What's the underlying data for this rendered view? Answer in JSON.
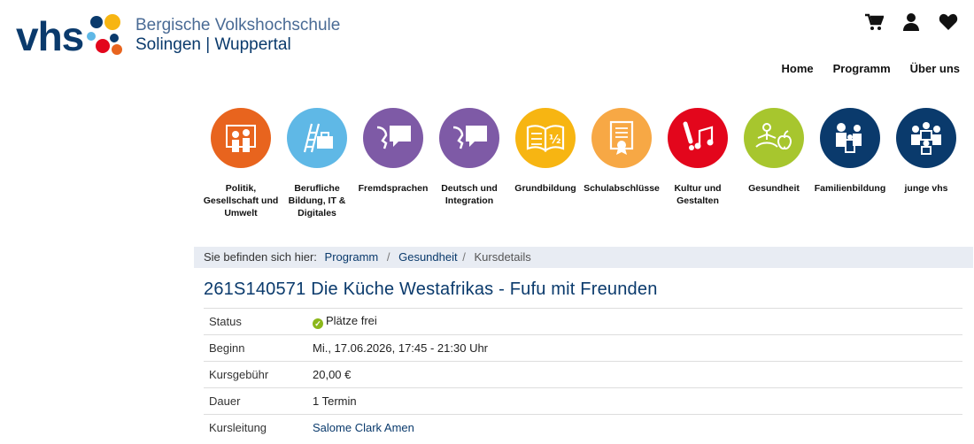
{
  "brand": {
    "logo_text": "vhs",
    "org_line1": "Bergische Volkshochschule",
    "org_line2": "Solingen | Wuppertal"
  },
  "utility_icons": [
    "cart-icon",
    "user-icon",
    "heart-icon"
  ],
  "nav": {
    "items": [
      {
        "label": "Home"
      },
      {
        "label": "Programm"
      },
      {
        "label": "Über uns"
      }
    ]
  },
  "categories": [
    {
      "label": "Politik, Gesellschaft und Umwelt",
      "color": "#e8641e",
      "icon": "people-icon"
    },
    {
      "label": "Berufliche Bildung, IT & Digitales",
      "color": "#5fb8e6",
      "icon": "ladder-briefcase-icon"
    },
    {
      "label": "Fremdsprachen",
      "color": "#7e5aa6",
      "icon": "speech-icon"
    },
    {
      "label": "Deutsch und Integration",
      "color": "#7e5aa6",
      "icon": "speech-icon"
    },
    {
      "label": "Grundbildung",
      "color": "#f7b512",
      "icon": "book-icon"
    },
    {
      "label": "Schulabschlüsse",
      "color": "#f7a845",
      "icon": "certificate-icon"
    },
    {
      "label": "Kultur und Gestalten",
      "color": "#e3061c",
      "icon": "music-icon"
    },
    {
      "label": "Gesundheit",
      "color": "#a7c62e",
      "icon": "yoga-apple-icon"
    },
    {
      "label": "Familienbildung",
      "color": "#0a3a6c",
      "icon": "family-icon"
    },
    {
      "label": "junge vhs",
      "color": "#0a3a6c",
      "icon": "group-icon"
    }
  ],
  "breadcrumb": {
    "label": "Sie befinden sich hier:",
    "items": [
      "Programm",
      "Gesundheit"
    ],
    "current": "Kursdetails"
  },
  "course": {
    "title": "261S140571 Die Küche Westafrikas - Fufu mit Freunden",
    "rows": [
      {
        "key": "Status",
        "value": "Plätze frei"
      },
      {
        "key": "Beginn",
        "value": "Mi., 17.06.2026, 17:45 - 21:30 Uhr"
      },
      {
        "key": "Kursgebühr",
        "value": "20,00 €"
      },
      {
        "key": "Dauer",
        "value": "1 Termin"
      },
      {
        "key": "Kursleitung",
        "value": "Salome Clark Amen"
      }
    ]
  }
}
